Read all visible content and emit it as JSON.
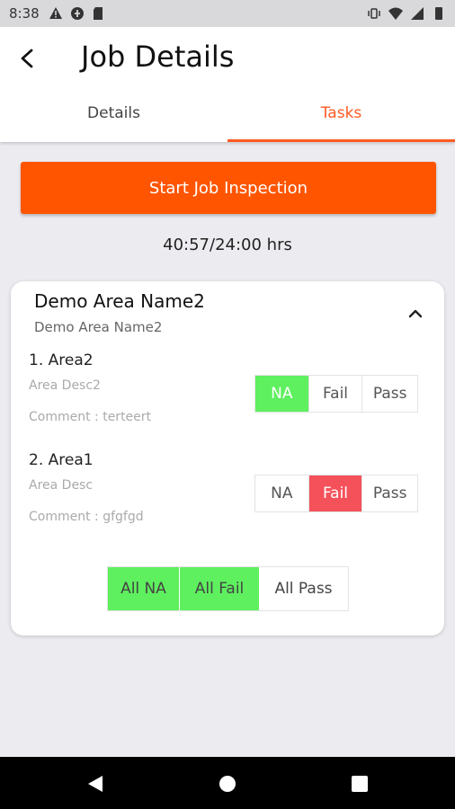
{
  "status_bar": {
    "time": "8:38",
    "left_icons": [
      "alert-icon",
      "data-saver-icon",
      "sd-card-icon"
    ],
    "right_icons": [
      "vibrate-icon",
      "wifi-icon",
      "signal-icon",
      "battery-icon"
    ]
  },
  "app_bar": {
    "title": "Job Details",
    "back_icon": "back-arrow-icon"
  },
  "tabs": [
    {
      "label": "Details",
      "active": false
    },
    {
      "label": "Tasks",
      "active": true
    }
  ],
  "start_button": {
    "label": "Start Job Inspection"
  },
  "timer_text": "40:57/24:00 hrs",
  "area": {
    "name": "Demo Area Name2",
    "description": "Demo Area Name2",
    "expanded_icon": "chevron-up-icon",
    "tasks": [
      {
        "title": "1. Area2",
        "description": "Area Desc2",
        "comment": "Comment : terteert",
        "options": [
          "NA",
          "Fail",
          "Pass"
        ],
        "selected": "NA"
      },
      {
        "title": "2. Area1",
        "description": "Area Desc",
        "comment": "Comment : gfgfgd",
        "options": [
          "NA",
          "Fail",
          "Pass"
        ],
        "selected": "Fail"
      }
    ],
    "bulk_actions": [
      "All NA",
      "All Fail",
      "All Pass"
    ]
  },
  "colors": {
    "accent": "#ff5500",
    "selected_green": "#5ef05e",
    "selected_red": "#f4515a",
    "background": "#ececf0"
  },
  "nav_bar": [
    "nav-back-icon",
    "nav-home-icon",
    "nav-recents-icon"
  ]
}
